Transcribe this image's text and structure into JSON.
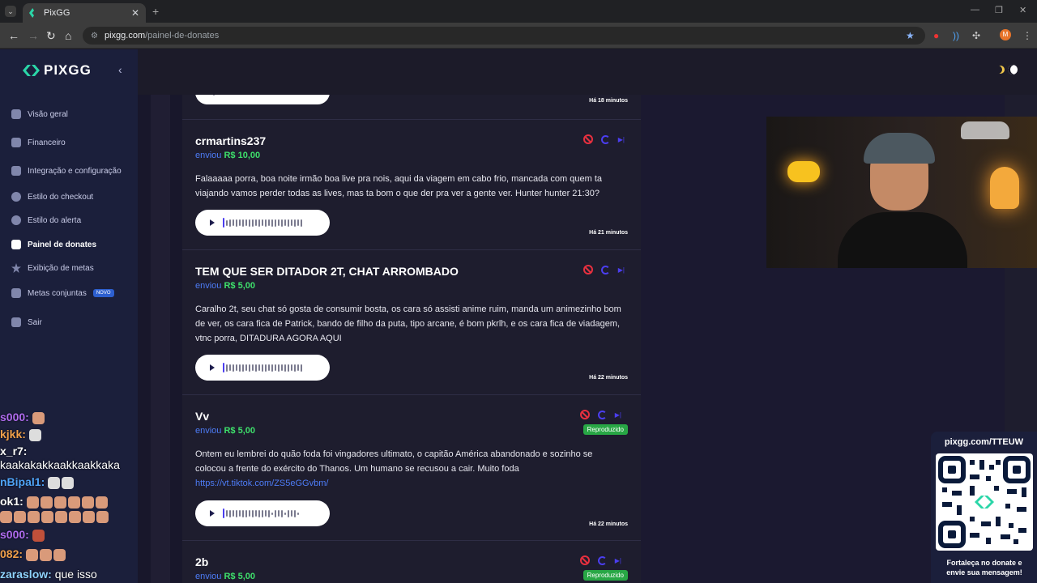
{
  "browser": {
    "tab_title": "PixGG",
    "url_domain": "pixgg.com",
    "url_path": "/painel-de-donates",
    "profile_initial": "M"
  },
  "sidebar": {
    "brand": "PIXGG",
    "items": [
      {
        "label": "Visão geral",
        "icon": "home-icon"
      },
      {
        "label": "Financeiro",
        "icon": "wallet-icon"
      },
      {
        "label": "Integração e configuração",
        "icon": "settings-icon"
      },
      {
        "label": "Estilo do checkout",
        "icon": "palette-icon"
      },
      {
        "label": "Estilo do alerta",
        "icon": "palette-icon"
      },
      {
        "label": "Painel de donates",
        "icon": "donate-icon",
        "active": true
      },
      {
        "label": "Exibição de metas",
        "icon": "star-icon"
      },
      {
        "label": "Metas conjuntas",
        "icon": "rocket-icon",
        "badge": "NOVO"
      },
      {
        "label": "Sair",
        "icon": "logout-icon"
      }
    ]
  },
  "feed": {
    "sent_label": "enviou",
    "top_time": "Há 18 minutos",
    "donations": [
      {
        "donor": "crmartins237",
        "amount": "R$ 10,00",
        "message": "Falaaaaa porra, boa noite irmão boa live pra nois, aqui da viagem em cabo frio, mancada com quem ta viajando vamos perder todas as lives, mas ta bom o que der pra ver a gente ver. Hunter hunter 21:30?",
        "time": "Há 21 minutos"
      },
      {
        "donor": "TEM QUE SER DITADOR 2T, CHAT ARROMBADO",
        "amount": "R$ 5,00",
        "message": "Caralho 2t, seu chat só gosta de consumir bosta, os cara só assisti anime ruim, manda um animezinho bom de ver, os cara fica de Patrick, bando de filho da puta, tipo arcane, é bom pkrlh, e os cara fica de viadagem, vtnc porra, DITADURA AGORA AQUI",
        "time": "Há 22 minutos"
      },
      {
        "donor": "Vv",
        "amount": "R$ 5,00",
        "message": "Ontem eu lembrei do quão foda foi vingadores ultimato, o capitão América abandonado e sozinho se colocou a frente do exército do Thanos. Um humano se recusou a cair. Muito foda",
        "link": "https://vt.tiktok.com/ZS5eGGvbm/",
        "status": "Reproduzido",
        "time": "Há 22 minutos"
      },
      {
        "donor": "2b",
        "amount": "R$ 5,00",
        "status": "Reproduzido"
      }
    ]
  },
  "chat": {
    "lines": [
      {
        "user": "s000:",
        "text": ""
      },
      {
        "user": "kjkk:",
        "text": ""
      },
      {
        "user": "x_r7:",
        "text": ""
      },
      {
        "user": "",
        "text": "kaakakakkaakkaakkaka"
      },
      {
        "user": "nBipal1:",
        "text": ""
      },
      {
        "user": "ok1:",
        "text": ""
      },
      {
        "user": "s000:",
        "text": ""
      },
      {
        "user": "082:",
        "text": ""
      },
      {
        "user": "zaraslow:",
        "text": "que isso"
      }
    ]
  },
  "qr_widget": {
    "url": "pixgg.com/TTEUW",
    "caption_line1": "Fortaleça no donate e",
    "caption_line2": "envie sua mensagem!"
  },
  "colors": {
    "accent": "#2bd6a8",
    "sidebar_bg": "#1b1f3b",
    "amount_green": "#3ee06b",
    "link_blue": "#4d7cf6",
    "played_badge": "#28a745",
    "ban_red": "#e8303f"
  }
}
